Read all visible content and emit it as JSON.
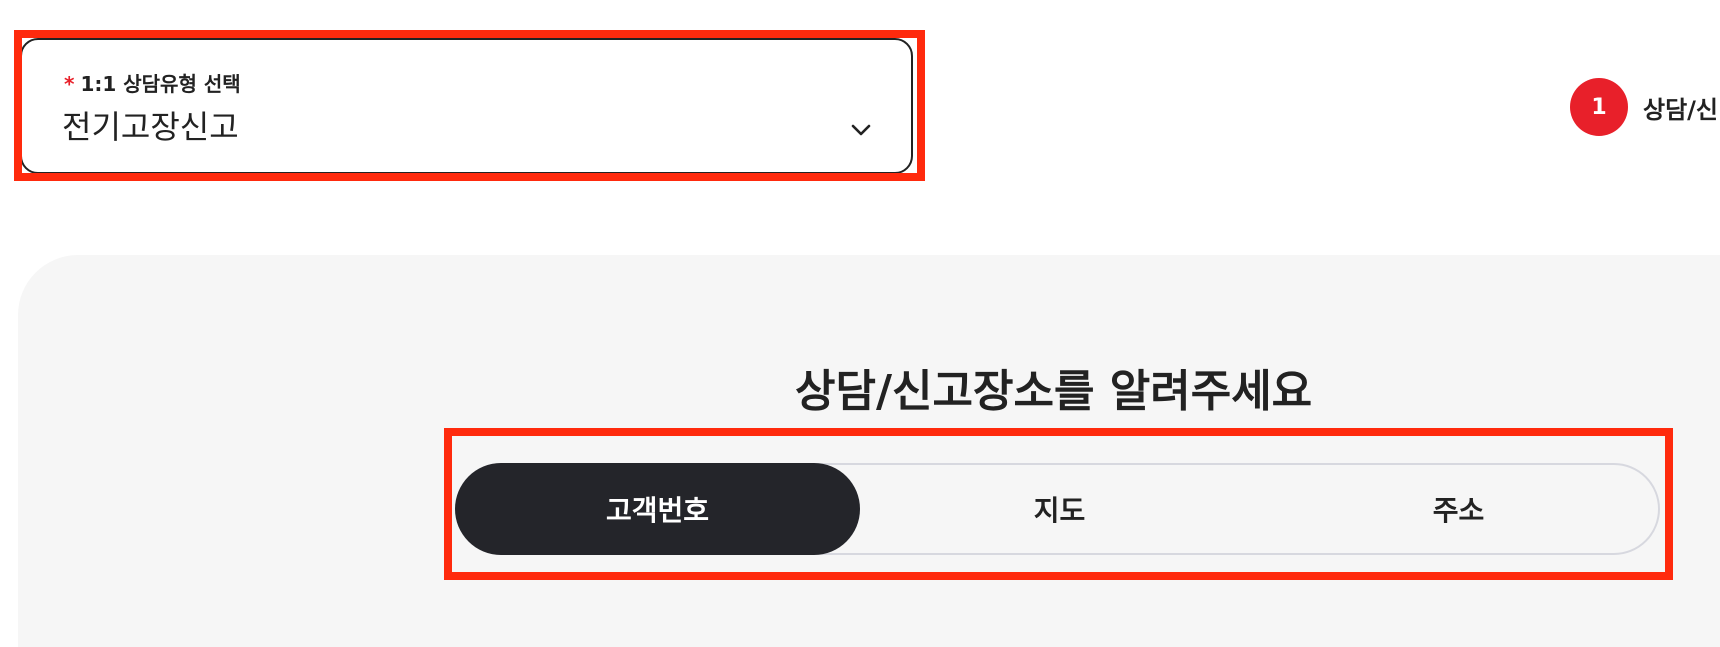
{
  "select": {
    "required_mark": "*",
    "label": "1:1 상담유형 선택",
    "value": "전기고장신고"
  },
  "step": {
    "number": "1",
    "label": "상담/신"
  },
  "panel": {
    "title": "상담/신고장소를 알려주세요"
  },
  "tabs": [
    {
      "label": "고객번호",
      "active": true
    },
    {
      "label": "지도",
      "active": false
    },
    {
      "label": "주소",
      "active": false
    }
  ],
  "colors": {
    "accent_red": "#e8202a",
    "active_tab_bg": "#24252a",
    "annotation_red": "#ff2a0d",
    "panel_bg": "#f6f6f6"
  },
  "icons": {
    "select_chevron": "chevron-down-icon"
  }
}
